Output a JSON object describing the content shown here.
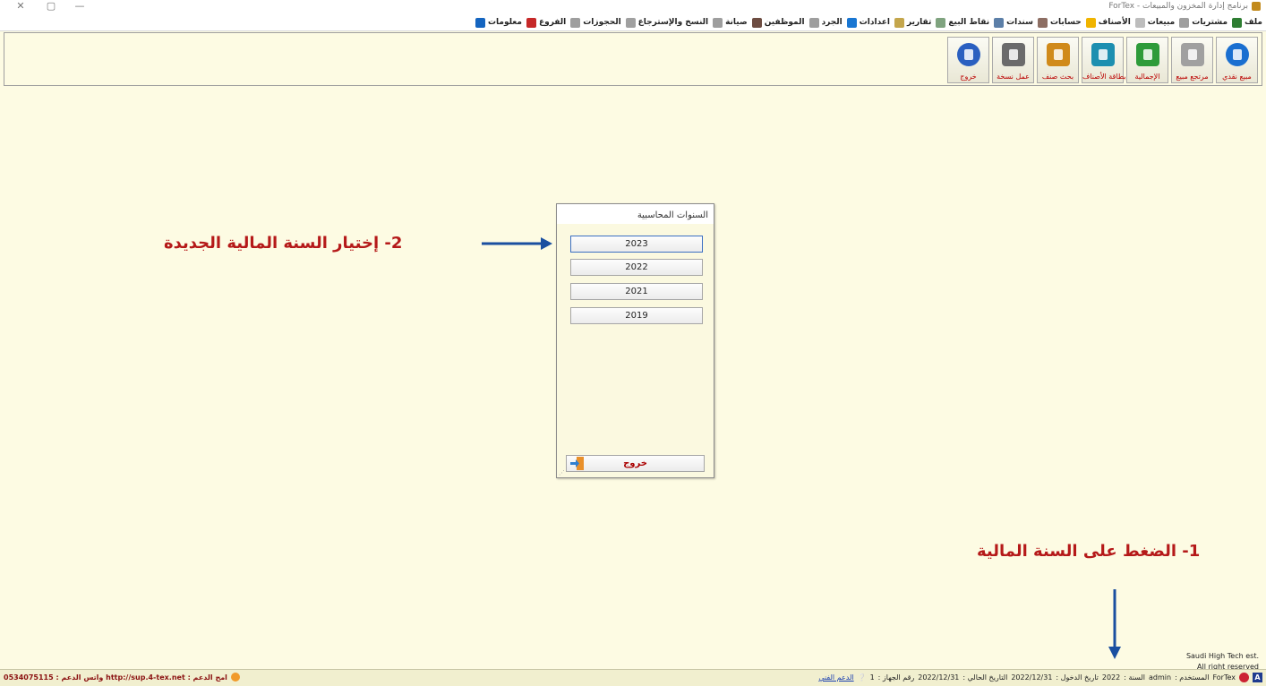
{
  "window": {
    "title": "برنامج إدارة المخزون والمبيعات - ForTex",
    "close_glyph": "✕",
    "restore_glyph": "▢",
    "minimize_glyph": "—"
  },
  "menu": {
    "items": [
      {
        "label": "ملف",
        "icon": "file-icon",
        "color": "#2e7d32"
      },
      {
        "label": "مشتريات",
        "icon": "document-icon",
        "color": "#9e9e9e"
      },
      {
        "label": "مبيعات",
        "icon": "document-icon",
        "color": "#bdbdbd"
      },
      {
        "label": "الأصناف",
        "icon": "folder-icon",
        "color": "#f0b400"
      },
      {
        "label": "حسابات",
        "icon": "bag-icon",
        "color": "#8d6e63"
      },
      {
        "label": "سندات",
        "icon": "hat-icon",
        "color": "#5c7fa8"
      },
      {
        "label": "نقاط البيع",
        "icon": "pos-icon",
        "color": "#7fa37f"
      },
      {
        "label": "تقارير",
        "icon": "chart-icon",
        "color": "#c4a64c"
      },
      {
        "label": "اعدادات",
        "icon": "gear-icon",
        "color": "#1976d2"
      },
      {
        "label": "الجرد",
        "icon": "list-icon",
        "color": "#9e9e9e"
      },
      {
        "label": "الموظفين",
        "icon": "user-icon",
        "color": "#6d4c41"
      },
      {
        "label": "صيانة",
        "icon": "wrench-icon",
        "color": "#9e9e9e"
      },
      {
        "label": "النسخ والإسترجاع",
        "icon": "database-icon",
        "color": "#a0a0a0"
      },
      {
        "label": "الحجوزات",
        "icon": "calendar-icon",
        "color": "#9e9e9e"
      },
      {
        "label": "الفروع",
        "icon": "store-icon",
        "color": "#c62828"
      },
      {
        "label": "معلومات",
        "icon": "info-icon",
        "color": "#1565c0"
      }
    ]
  },
  "toolbar": {
    "buttons": [
      {
        "label": "مبيع نقدي",
        "icon": "cash-sale-icon",
        "color": "#1a6fd0"
      },
      {
        "label": "مرتجع مبيع",
        "icon": "sales-return-icon",
        "color": "#a0a0a0"
      },
      {
        "label": "الإجمالية",
        "icon": "money-icon",
        "color": "#2e9b3a"
      },
      {
        "label": "بطاقة الأصناف",
        "icon": "item-card-icon",
        "color": "#1d8fb0"
      },
      {
        "label": "بحث صنف",
        "icon": "item-search-icon",
        "color": "#d08a1a"
      },
      {
        "label": "عمل نسخة",
        "icon": "backup-icon",
        "color": "#6b6b6b"
      },
      {
        "label": "خروج",
        "icon": "lock-icon",
        "color": "#2a5fc0"
      }
    ]
  },
  "dialog": {
    "title": "السنوات المحاسبية",
    "years": [
      "2023",
      "2022",
      "2021",
      "2019"
    ],
    "exit_label": "خروج"
  },
  "annotations": {
    "step2": "2- إختيار السنة المالية الجديدة",
    "step1": "1- الضغط على السنة المالية",
    "color": "#b51919",
    "arrow_color": "#1a4fa0"
  },
  "copyright": {
    "line1": "Saudi High Tech est.",
    "line2": "All right reserved"
  },
  "statusbar": {
    "a_label": "A",
    "app": "ForTex",
    "user_label": "المستخدم :",
    "user": "admin",
    "year_label": "السنة :",
    "year": "2022",
    "login_date_label": "تاريخ الدخول :",
    "login_date": "2022/12/31",
    "current_date_label": "التاريخ الحالي :",
    "current_date": "2022/12/31",
    "device_label": "رقم الجهاز :",
    "device": "1",
    "support_link": "الدعم الفني",
    "left_text": "امح الدعم : http://sup.4-tex.net واتس الدعم : 0534075115"
  }
}
